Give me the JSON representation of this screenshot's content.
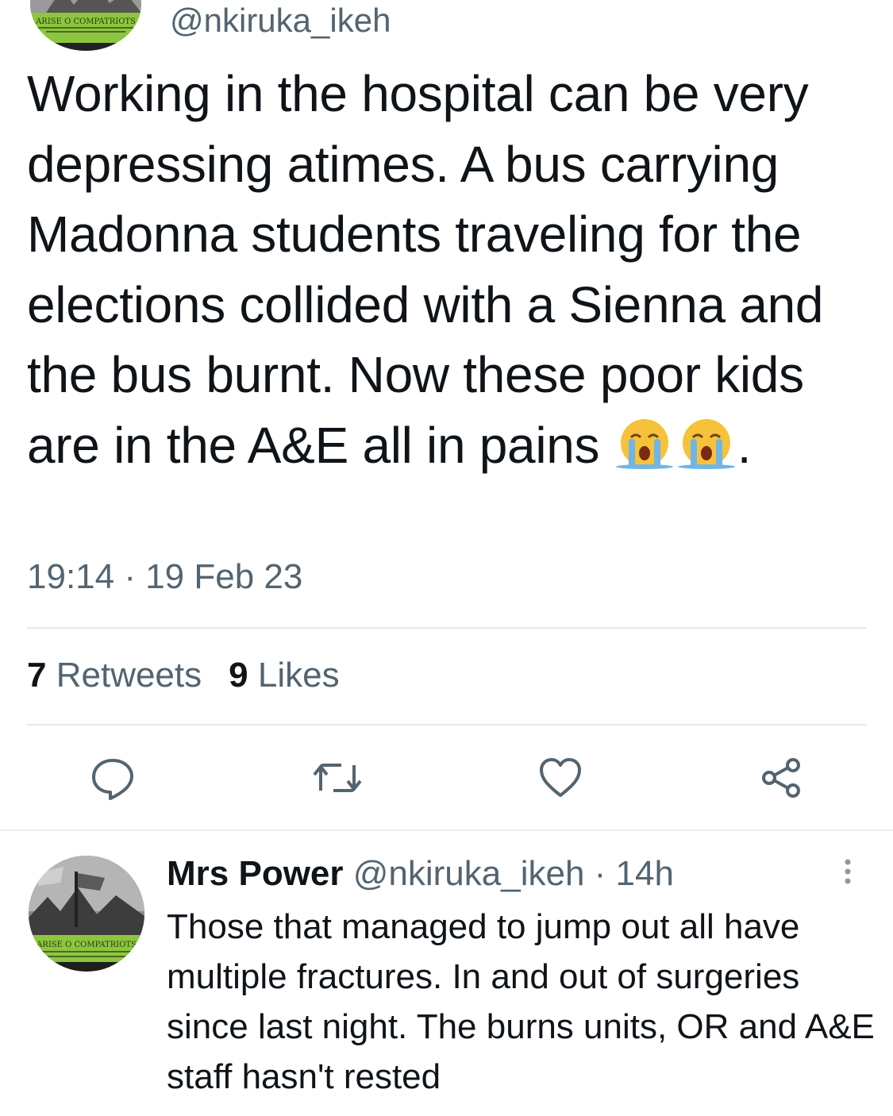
{
  "tweet": {
    "handle": "@nkiruka_ikeh",
    "avatar_badge": "ARISE O COMPATRIOTS",
    "text_before_emoji": "Working in the hospital can be very depressing atimes. A bus carrying Madonna students traveling for the elections collided with a Sienna and the bus burnt. Now these poor kids are in the A&E all in pains ",
    "text_after_emoji": ".",
    "emojis": [
      "loudly-crying-face",
      "loudly-crying-face"
    ],
    "timestamp": "19:14 · 19 Feb 23",
    "retweets_count": "7",
    "retweets_label": "Retweets",
    "likes_count": "9",
    "likes_label": "Likes"
  },
  "actions": {
    "reply_icon": "reply-icon",
    "retweet_icon": "retweet-icon",
    "like_icon": "heart-icon",
    "share_icon": "share-icon"
  },
  "reply": {
    "name": "Mrs Power",
    "handle_time": " @nkiruka_ikeh · 14h",
    "avatar_badge": "ARISE O COMPATRIOTS",
    "text": "Those that managed to jump out all have multiple fractures. In and out of surgeries since last night. The burns units, OR and A&E staff hasn't rested"
  },
  "colors": {
    "text": "#0f1419",
    "secondary": "#536471",
    "divider": "#e6e9eb",
    "badge_green": "#8cc63f"
  }
}
